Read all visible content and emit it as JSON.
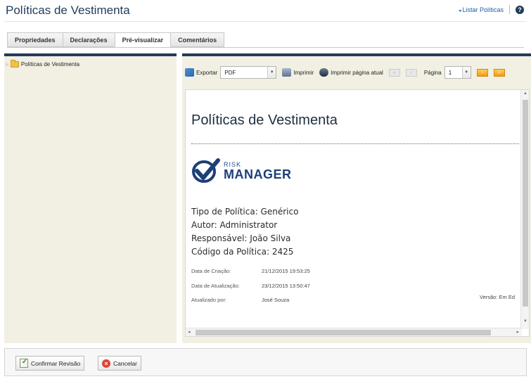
{
  "header": {
    "title": "Políticas de Vestimenta",
    "list_link": "Listar Políticas",
    "help_icon": "help-icon"
  },
  "tabs": [
    {
      "label": "Propriedades",
      "active": false
    },
    {
      "label": "Declarações",
      "active": false
    },
    {
      "label": "Pré-visualizar",
      "active": true
    },
    {
      "label": "Comentários",
      "active": false
    }
  ],
  "tree": {
    "root_label": "Políticas de Vestimenta",
    "icon": "folder-icon"
  },
  "toolbar": {
    "export_label": "Exportar",
    "format_value": "PDF",
    "print_label": "Imprimir",
    "print_page_label": "Imprimir página atual",
    "page_label": "Página",
    "page_value": "1"
  },
  "document": {
    "title": "Políticas de Vestimenta",
    "logo_small": "RISK",
    "logo_big": "MANAGER",
    "policy_type": "Tipo de Política: Genérico",
    "author": "Autor: Administrator",
    "responsible": "Responsável: João Silva",
    "policy_code": "Código da Política:  2425",
    "created_label": "Data de Criação:",
    "created_value": "21/12/2015 19:53:25",
    "updated_label": "Data de Atualização:",
    "updated_value": "23/12/2015 13:50:47",
    "updated_by_label": "Atualizado por:",
    "updated_by_value": "José Souza",
    "version": "Versão:  Em Ed"
  },
  "footer": {
    "confirm_label": "Confirmar Revisão",
    "cancel_label": "Cancelar"
  },
  "colors": {
    "accent": "#1f3b5a",
    "panel_bg": "#f2f0e3",
    "link": "#1a5fa8"
  }
}
